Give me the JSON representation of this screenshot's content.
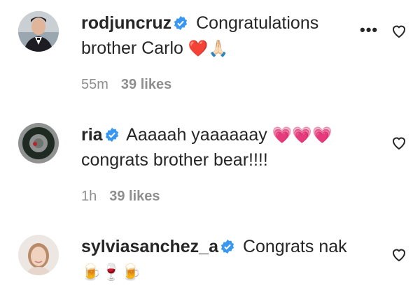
{
  "comments": [
    {
      "username": "rodjuncruz",
      "text_line1": "Congratulations",
      "text_line2": "brother Carlo",
      "emojis": "❤️🙏🏻",
      "time": "55m",
      "likes": "39 likes",
      "avatar_icon": "avatar-man-in-suit"
    },
    {
      "username": "ria",
      "text_line1": "Aaaaah yaaaaaay",
      "emojis": "💗💗💗",
      "text_line2": "congrats brother bear!!!!",
      "time": "1h",
      "likes": "39 likes",
      "avatar_icon": "avatar-wreath"
    },
    {
      "username": "sylviasanchez_a",
      "text_line1": "Congrats nak",
      "emojis": "🍺🍷🍺",
      "avatar_icon": "avatar-woman"
    }
  ],
  "colors": {
    "verified": "#3897f0",
    "meta": "#8e8e8e",
    "text": "#262626"
  }
}
